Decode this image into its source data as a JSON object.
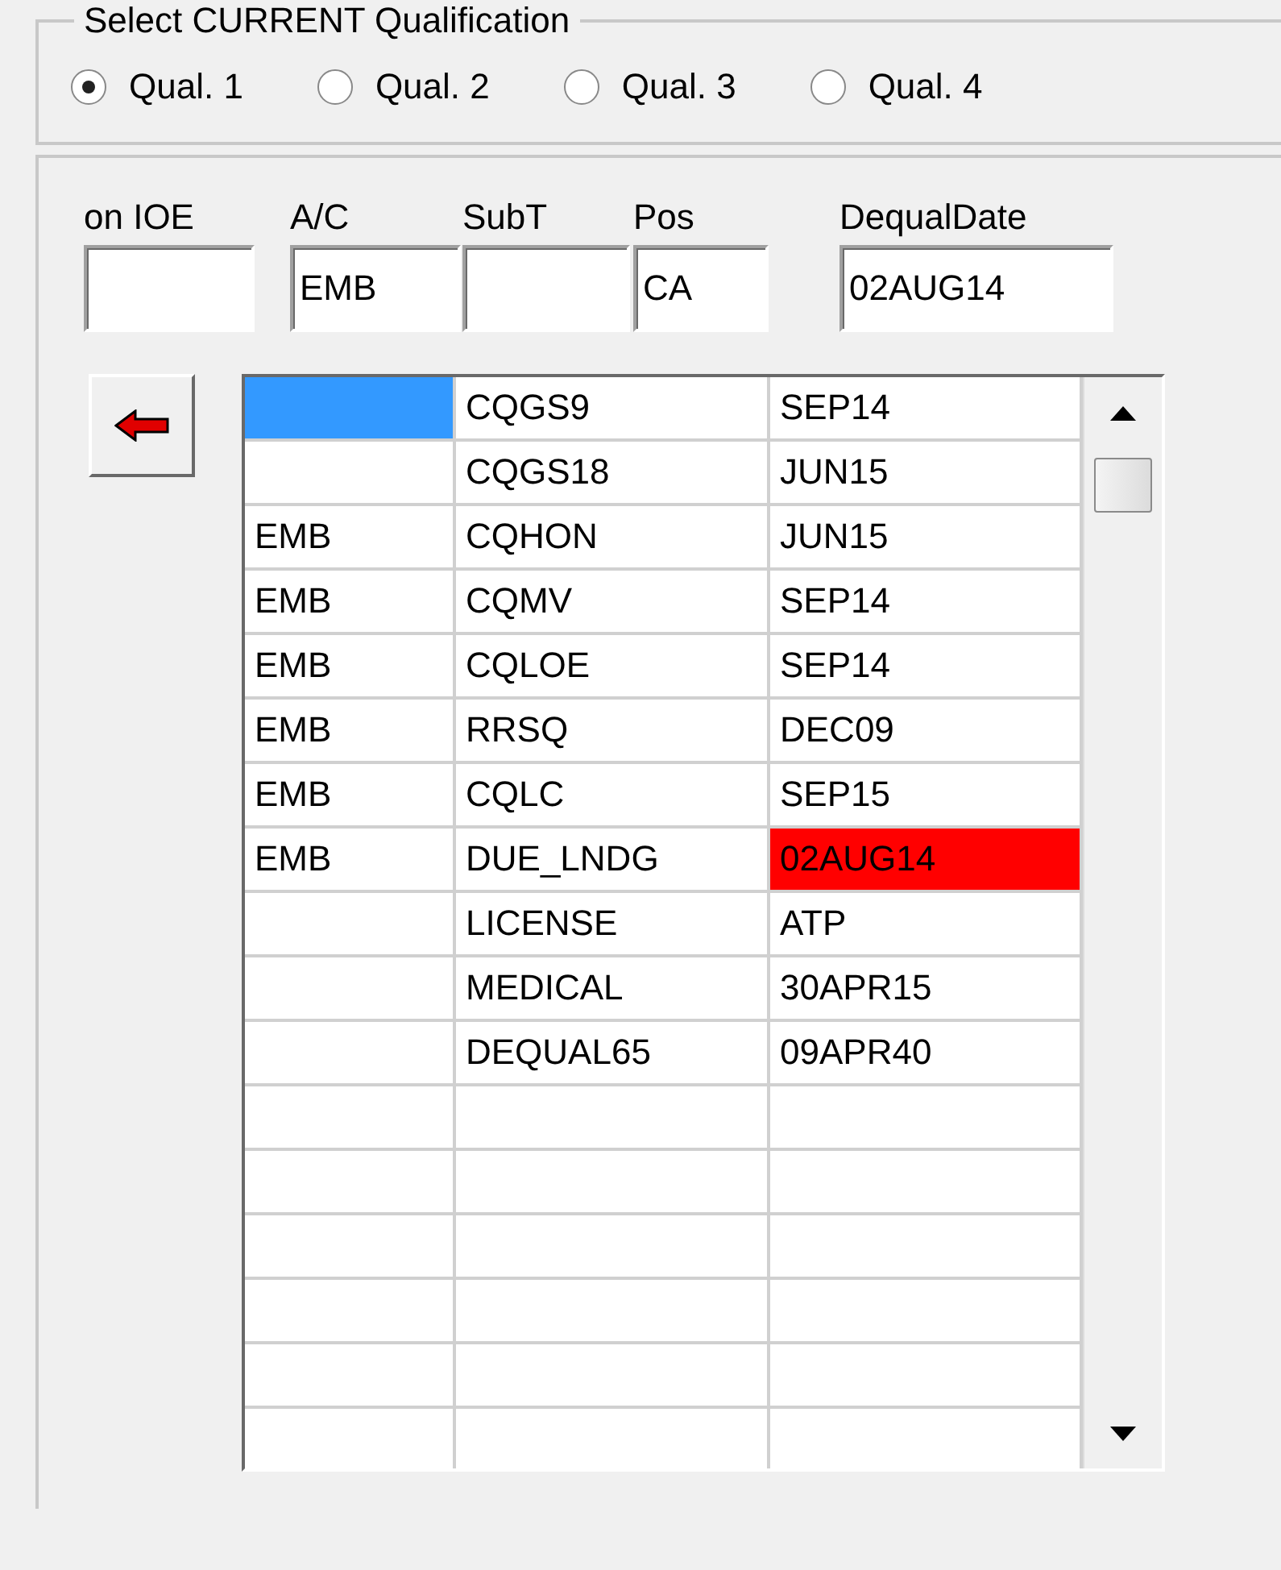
{
  "qualification_group": {
    "title": "Select CURRENT Qualification",
    "options": [
      {
        "label": "Qual. 1",
        "selected": true
      },
      {
        "label": "Qual. 2",
        "selected": false
      },
      {
        "label": "Qual. 3",
        "selected": false
      },
      {
        "label": "Qual. 4",
        "selected": false
      }
    ]
  },
  "fields": [
    {
      "label": "on IOE"
    },
    {
      "label": "A/C",
      "value": "EMB"
    },
    {
      "label": "SubT"
    },
    {
      "label": "Pos",
      "value": "CA"
    },
    {
      "label": "DequalDate",
      "value": "02AUG14"
    }
  ],
  "grid": {
    "rows": [
      {
        "item": "CQGS9",
        "date": "SEP14",
        "selected": true,
        "alert": false
      },
      {
        "item": "CQGS18",
        "date": "JUN15",
        "selected": false,
        "alert": false
      },
      {
        "ac": "EMB",
        "item": "CQHON",
        "date": "JUN15",
        "selected": false,
        "alert": false
      },
      {
        "ac": "EMB",
        "item": "CQMV",
        "date": "SEP14",
        "selected": false,
        "alert": false
      },
      {
        "ac": "EMB",
        "item": "CQLOE",
        "date": "SEP14",
        "selected": false,
        "alert": false
      },
      {
        "ac": "EMB",
        "item": "RRSQ",
        "date": "DEC09",
        "selected": false,
        "alert": false
      },
      {
        "ac": "EMB",
        "item": "CQLC",
        "date": "SEP15",
        "selected": false,
        "alert": false
      },
      {
        "ac": "EMB",
        "item": "DUE_LNDG",
        "date": "02AUG14",
        "selected": false,
        "alert": true
      },
      {
        "item": "LICENSE",
        "date": "ATP",
        "selected": false,
        "alert": false
      },
      {
        "item": "MEDICAL",
        "date": "30APR15",
        "selected": false,
        "alert": false
      },
      {
        "item": "DEQUAL65",
        "date": "09APR40",
        "selected": false,
        "alert": false
      }
    ]
  }
}
